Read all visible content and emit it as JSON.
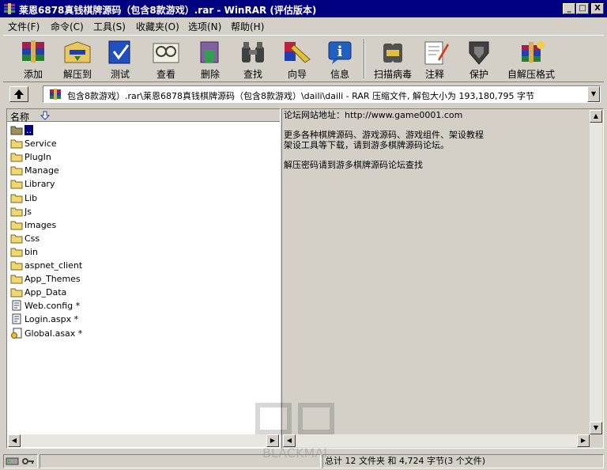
{
  "window": {
    "title": "莱恩6878真钱棋牌源码（包含8款游戏）.rar - WinRAR (评估版本)",
    "controls": {
      "minimize": "_",
      "maximize": "□",
      "close": "X"
    }
  },
  "menu": [
    "文件(F)",
    "命令(C)",
    "工具(S)",
    "收藏夹(O)",
    "选项(N)",
    "帮助(H)"
  ],
  "toolbar": {
    "buttons": [
      {
        "label": "添加",
        "icon": "add-archive-icon"
      },
      {
        "label": "解压到",
        "icon": "extract-to-icon"
      },
      {
        "label": "测试",
        "icon": "test-icon"
      },
      {
        "label": "查看",
        "icon": "view-icon"
      },
      {
        "label": "删除",
        "icon": "delete-icon"
      },
      {
        "label": "查找",
        "icon": "find-icon"
      },
      {
        "label": "向导",
        "icon": "wizard-icon"
      },
      {
        "label": "信息",
        "icon": "info-icon"
      },
      {
        "label": "扫描病毒",
        "icon": "scan-virus-icon"
      },
      {
        "label": "注释",
        "icon": "comment-icon"
      },
      {
        "label": "保护",
        "icon": "protect-icon"
      },
      {
        "label": "自解压格式",
        "icon": "sfx-icon"
      }
    ]
  },
  "address": {
    "path": "包含8款游戏）.rar\\莱恩6878真钱棋牌源码（包含8款游戏）\\daili\\daili - RAR 压缩文件, 解包大小为 193,180,795 字节"
  },
  "file_list": {
    "column_name": "名称",
    "items": [
      {
        "name": "..",
        "type": "folder",
        "selected": true
      },
      {
        "name": "Service",
        "type": "folder"
      },
      {
        "name": "PlugIn",
        "type": "folder"
      },
      {
        "name": "Manage",
        "type": "folder"
      },
      {
        "name": "Library",
        "type": "folder"
      },
      {
        "name": "Lib",
        "type": "folder"
      },
      {
        "name": "Js",
        "type": "folder"
      },
      {
        "name": "Images",
        "type": "folder"
      },
      {
        "name": "Css",
        "type": "folder"
      },
      {
        "name": "bin",
        "type": "folder"
      },
      {
        "name": "aspnet_client",
        "type": "folder"
      },
      {
        "name": "App_Themes",
        "type": "folder"
      },
      {
        "name": "App_Data",
        "type": "folder"
      },
      {
        "name": "Web.config *",
        "type": "config"
      },
      {
        "name": "Login.aspx *",
        "type": "aspx"
      },
      {
        "name": "Global.asax *",
        "type": "asax"
      }
    ]
  },
  "comment": {
    "lines": [
      "论坛网站地址：http://www.game0001.com",
      "",
      "更多各种棋牌源码、游戏源码、游戏组件、架设教程",
      "架设工具等下载，请到游多棋牌源码论坛。",
      "",
      "解压密码请到游多棋牌源码论坛查找"
    ]
  },
  "status": {
    "summary": "总计 12 文件夹 和 4,724 字节(3 个文件)"
  },
  "watermark": {
    "text": "BLACKMAI"
  }
}
